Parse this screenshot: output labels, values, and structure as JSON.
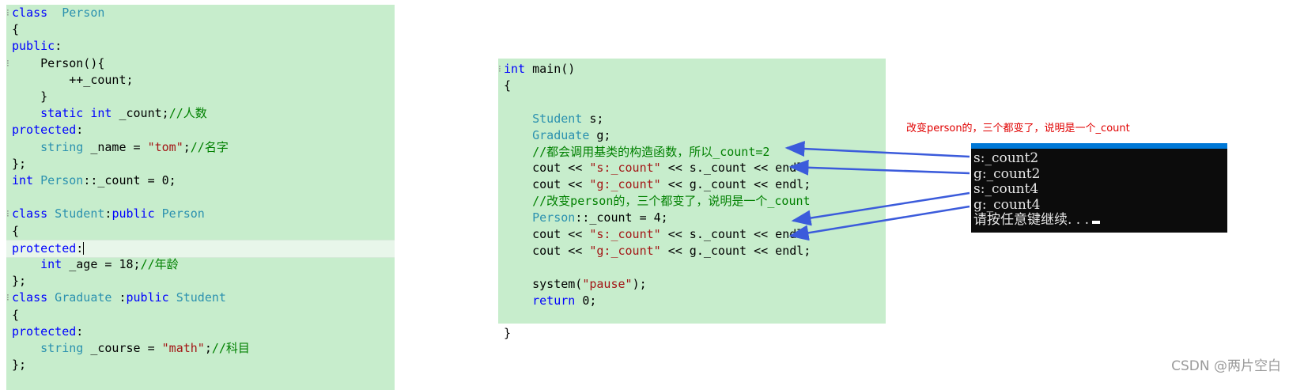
{
  "left_code": [
    [
      [
        "kw",
        "class"
      ],
      [
        "",
        "  "
      ],
      [
        "ty",
        "Person"
      ]
    ],
    [
      [
        "",
        "{"
      ]
    ],
    [
      [
        "kw",
        "public"
      ],
      [
        "",
        ":"
      ]
    ],
    [
      [
        "",
        "    Person(){"
      ]
    ],
    [
      [
        "",
        "        ++_count;"
      ]
    ],
    [
      [
        "",
        "    }"
      ]
    ],
    [
      [
        "",
        "    "
      ],
      [
        "kw",
        "static int"
      ],
      [
        "",
        " _count;"
      ],
      [
        "cm",
        "//人数"
      ]
    ],
    [
      [
        "kw",
        "protected"
      ],
      [
        "",
        ":"
      ]
    ],
    [
      [
        "",
        "    "
      ],
      [
        "ty",
        "string"
      ],
      [
        "",
        " _name = "
      ],
      [
        "st",
        "\"tom\""
      ],
      [
        "",
        ";"
      ],
      [
        "cm",
        "//名字"
      ]
    ],
    [
      [
        "",
        "};"
      ]
    ],
    [
      [
        "kw",
        "int"
      ],
      [
        "ty",
        " Person"
      ],
      [
        "",
        "::_count = 0;"
      ]
    ],
    [
      [
        "",
        ""
      ]
    ],
    [
      [
        "kw",
        "class"
      ],
      [
        "ty",
        " Student"
      ],
      [
        "",
        ":"
      ],
      [
        "kw",
        "public"
      ],
      [
        "ty",
        " Person"
      ]
    ],
    [
      [
        "",
        "{"
      ]
    ],
    [
      [
        "kw",
        "protected"
      ],
      [
        "",
        ":"
      ]
    ],
    [
      [
        "",
        "    "
      ],
      [
        "kw",
        "int"
      ],
      [
        "",
        " _age = 18;"
      ],
      [
        "cm",
        "//年龄"
      ]
    ],
    [
      [
        "",
        "};"
      ]
    ],
    [
      [
        "kw",
        "class"
      ],
      [
        "ty",
        " Graduate"
      ],
      [
        "",
        " :"
      ],
      [
        "kw",
        "public"
      ],
      [
        "ty",
        " Student"
      ]
    ],
    [
      [
        "",
        "{"
      ]
    ],
    [
      [
        "kw",
        "protected"
      ],
      [
        "",
        ":"
      ]
    ],
    [
      [
        "",
        "    "
      ],
      [
        "ty",
        "string"
      ],
      [
        "",
        " _course = "
      ],
      [
        "st",
        "\"math\""
      ],
      [
        "",
        ";"
      ],
      [
        "cm",
        "//科目"
      ]
    ],
    [
      [
        "",
        "};"
      ]
    ]
  ],
  "right_code": [
    [
      [
        "kw",
        "int"
      ],
      [
        "",
        " main()"
      ]
    ],
    [
      [
        "",
        "{"
      ]
    ],
    [
      [
        "",
        ""
      ]
    ],
    [
      [
        "",
        "    "
      ],
      [
        "ty",
        "Student"
      ],
      [
        "",
        " s;"
      ]
    ],
    [
      [
        "",
        "    "
      ],
      [
        "ty",
        "Graduate"
      ],
      [
        "",
        " g;"
      ]
    ],
    [
      [
        "",
        "    "
      ],
      [
        "cm",
        "//都会调用基类的构造函数，所以_count=2"
      ]
    ],
    [
      [
        "",
        "    cout << "
      ],
      [
        "st",
        "\"s:_count\""
      ],
      [
        "",
        " << s._count << endl;"
      ]
    ],
    [
      [
        "",
        "    cout << "
      ],
      [
        "st",
        "\"g:_count\""
      ],
      [
        "",
        " << g._count << endl;"
      ]
    ],
    [
      [
        "",
        "    "
      ],
      [
        "cm",
        "//改变person的，三个都变了，说明是一个_count"
      ]
    ],
    [
      [
        "",
        "    "
      ],
      [
        "ty",
        "Person"
      ],
      [
        "",
        "::_count = 4;"
      ]
    ],
    [
      [
        "",
        "    cout << "
      ],
      [
        "st",
        "\"s:_count\""
      ],
      [
        "",
        " << s._count << endl;"
      ]
    ],
    [
      [
        "",
        "    cout << "
      ],
      [
        "st",
        "\"g:_count\""
      ],
      [
        "",
        " << g._count << endl;"
      ]
    ],
    [
      [
        "",
        ""
      ]
    ],
    [
      [
        "",
        "    system("
      ],
      [
        "st",
        "\"pause\""
      ],
      [
        "",
        ");"
      ]
    ],
    [
      [
        "",
        "    "
      ],
      [
        "kw",
        "return"
      ],
      [
        "",
        " 0;"
      ]
    ],
    [
      [
        "",
        ""
      ]
    ],
    [
      [
        "",
        "}"
      ]
    ]
  ],
  "console": {
    "lines": [
      "s:_count2",
      "g:_count2",
      "s:_count4",
      "g:_count4",
      "请按任意键继续. . ."
    ]
  },
  "annotation": "改变person的，三个都变了，说明是一个_count",
  "watermark": "CSDN @两片空白",
  "colors": {
    "editor_bg": "#c7edcc",
    "keyword": "#0000ff",
    "type": "#2b91af",
    "comment": "#008000",
    "string": "#a31515",
    "console_bg": "#0c0c0c",
    "console_title": "#0078d7",
    "annotation": "#e00000",
    "arrow": "#3b5bdb"
  }
}
